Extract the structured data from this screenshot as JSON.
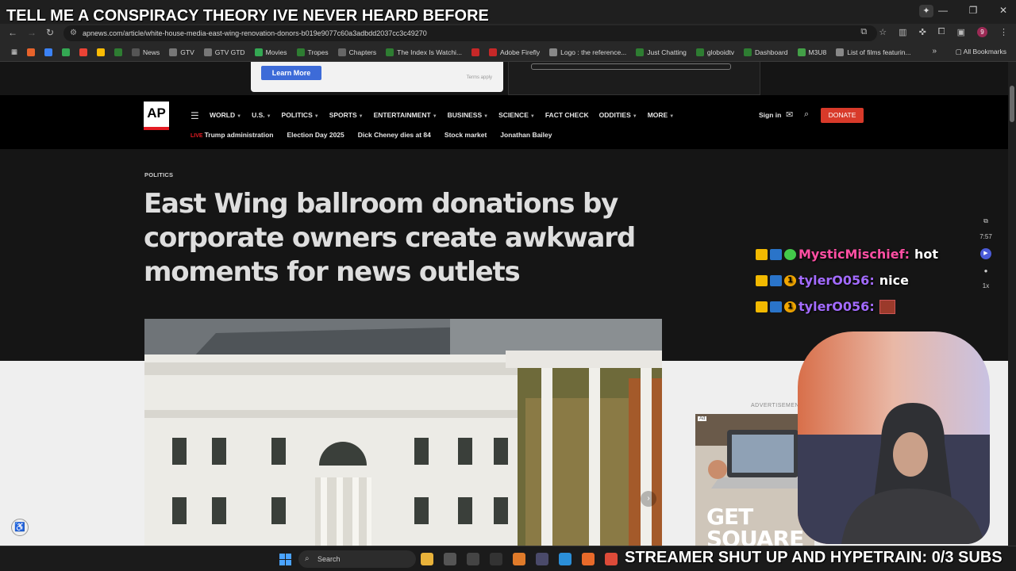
{
  "stream_overlay": {
    "top_text": "TELL ME A CONSPIRACY THEORY IVE NEVER HEARD BEFORE",
    "bottom_text": "STREAMER SHUT UP AND HYPETRAIN: 0/3 SUBS"
  },
  "browser": {
    "url": "apnews.com/article/white-house-media-east-wing-renovation-donors-b019e9077c60a3adbdd2037cc3c49270",
    "bookmarks": [
      {
        "label": "",
        "color": "#e8632b"
      },
      {
        "label": "",
        "color": "#3b82f6"
      },
      {
        "label": "",
        "color": "#34a853"
      },
      {
        "label": "",
        "color": "#ea4335"
      },
      {
        "label": "",
        "color": "#fbbc05"
      },
      {
        "label": "",
        "color": "#2e7d32"
      },
      {
        "label": "News",
        "color": "#555555"
      },
      {
        "label": "GTV",
        "color": "#777777"
      },
      {
        "label": "GTV GTD",
        "color": "#777777"
      },
      {
        "label": "Movies",
        "color": "#34a853"
      },
      {
        "label": "Tropes",
        "color": "#2e7d32"
      },
      {
        "label": "Chapters",
        "color": "#666666"
      },
      {
        "label": "The Index Is Watchi...",
        "color": "#2e7d32"
      },
      {
        "label": "",
        "color": "#c62828"
      },
      {
        "label": "Adobe Firefly",
        "color": "#c62828"
      },
      {
        "label": "Logo : the reference...",
        "color": "#888888"
      },
      {
        "label": "Just Chatting",
        "color": "#2e7d32"
      },
      {
        "label": "globoidtv",
        "color": "#2e7d32"
      },
      {
        "label": "Dashboard",
        "color": "#2e7d32"
      },
      {
        "label": "M3U8",
        "color": "#43a047"
      },
      {
        "label": "List of films featurin...",
        "color": "#888888"
      }
    ],
    "all_bookmarks": "All Bookmarks"
  },
  "ad_top": {
    "learn_more": "Learn More",
    "terms": "Terms apply"
  },
  "ap": {
    "logo": "AP",
    "nav": [
      "WORLD",
      "U.S.",
      "POLITICS",
      "SPORTS",
      "ENTERTAINMENT",
      "BUSINESS",
      "SCIENCE",
      "FACT CHECK",
      "ODDITIES",
      "MORE"
    ],
    "nav_has_caret": [
      true,
      true,
      true,
      true,
      true,
      true,
      true,
      false,
      true,
      true
    ],
    "signin": "Sign in",
    "donate": "DONATE",
    "live_label": "LIVE",
    "subnav": [
      "Trump administration",
      "Election Day 2025",
      "Dick Cheney dies at 84",
      "Stock market",
      "Jonathan Bailey"
    ]
  },
  "article": {
    "section": "POLITICS",
    "headline": "East Wing ballroom donations by corporate owners create awkward moments for news outlets"
  },
  "side_ad": {
    "label": "ADVERTISEMENT",
    "ad_tag": "Ad",
    "text_1": "GET",
    "text_2": "SQUARE"
  },
  "side_tools": {
    "time": "7:57",
    "speed": "1x"
  },
  "chat": [
    {
      "user": "MysticMischief",
      "message": "hot",
      "user_color": "#ff4fa3",
      "badge": "green"
    },
    {
      "user": "tylerO056",
      "message": "nice",
      "user_color": "#a36bff",
      "badge": "gold"
    },
    {
      "user": "tylerO056",
      "message": "",
      "user_color": "#a36bff",
      "badge": "gold",
      "emote": true
    }
  ],
  "taskbar": {
    "search_placeholder": "Search"
  }
}
